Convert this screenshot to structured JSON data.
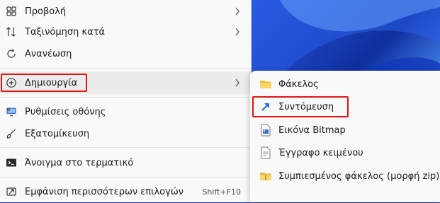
{
  "menu": {
    "items": [
      {
        "label": "Προβολή",
        "icon": "grid-view-icon"
      },
      {
        "label": "Ταξινόμηση κατά",
        "icon": "sort-icon"
      },
      {
        "label": "Ανανέωση",
        "icon": "refresh-icon"
      },
      {
        "label": "Δημιουργία",
        "icon": "add-circle-icon"
      },
      {
        "label": "Ρυθμίσεις οθόνης",
        "icon": "display-settings-icon"
      },
      {
        "label": "Εξατομίκευση",
        "icon": "personalize-brush-icon"
      },
      {
        "label": "Άνοιγμα στο τερματικό",
        "icon": "terminal-icon"
      },
      {
        "label": "Εμφάνιση περισσότερων επιλογών",
        "icon": "show-more-icon",
        "shortcut": "Shift+F10"
      }
    ]
  },
  "submenu": {
    "items": [
      {
        "label": "Φάκελος",
        "icon": "folder-icon"
      },
      {
        "label": "Συντόμευση",
        "icon": "shortcut-arrow-icon"
      },
      {
        "label": "Εικόνα Bitmap",
        "icon": "bitmap-image-icon"
      },
      {
        "label": "Έγγραφο κειμένου",
        "icon": "text-document-icon"
      },
      {
        "label": "Συμπιεσμένος φάκελος (μορφή zip)",
        "icon": "zip-folder-icon"
      }
    ]
  },
  "colors": {
    "highlight": "#e01414",
    "folder": "#f5c84a",
    "shortcut_arrow": "#1f6fd0",
    "wallpaper": "#1b3aa8"
  }
}
